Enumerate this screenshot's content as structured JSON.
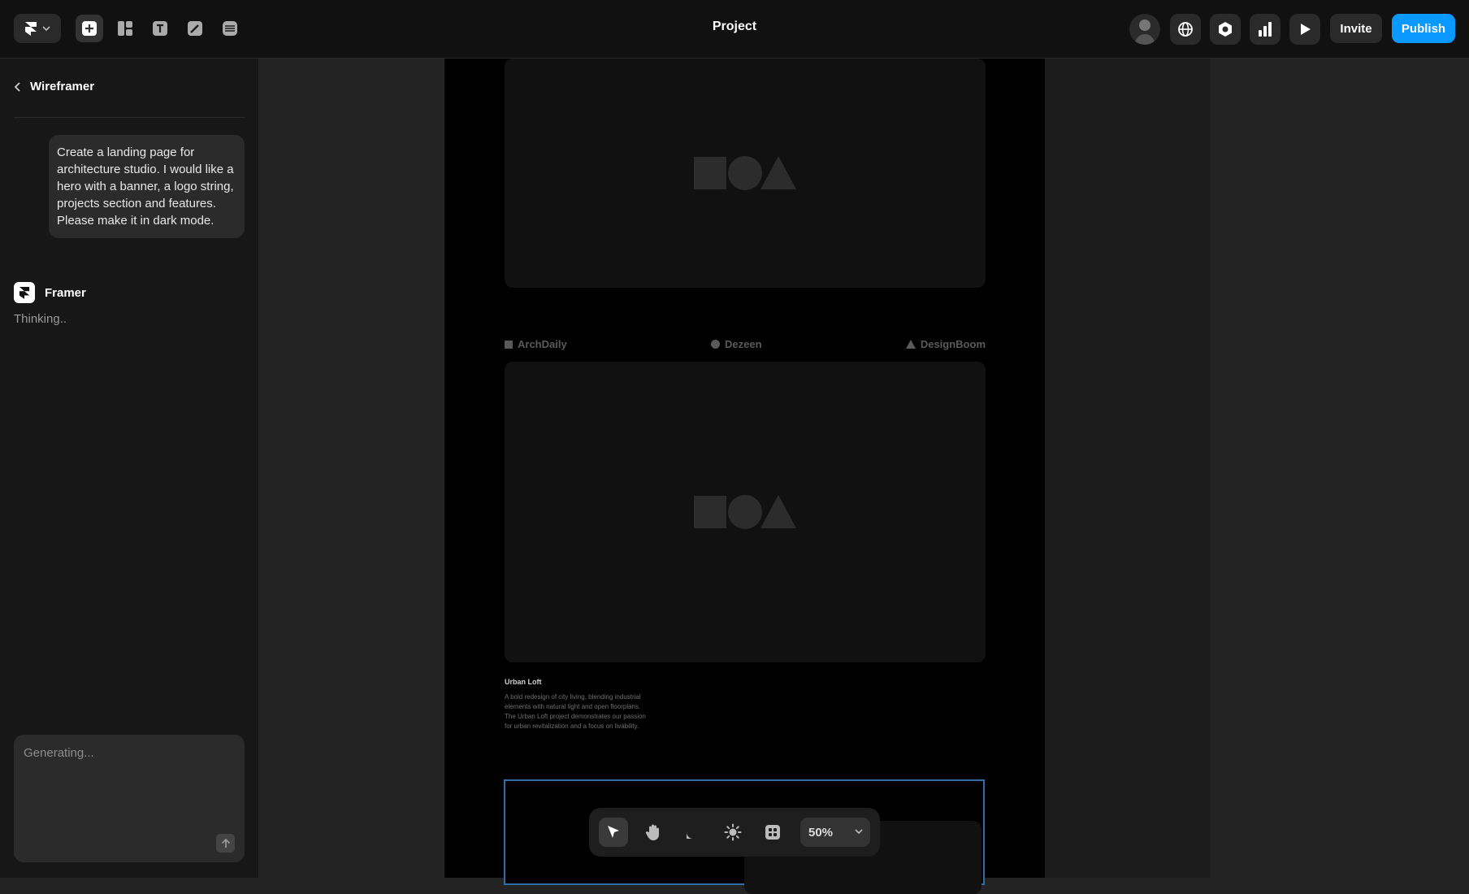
{
  "header": {
    "project_title": "Project",
    "tools": [
      {
        "name": "insert",
        "icon": "plus-square-icon"
      },
      {
        "name": "layout",
        "icon": "layout-icon"
      },
      {
        "name": "text",
        "icon": "text-icon"
      },
      {
        "name": "vector",
        "icon": "pen-icon"
      },
      {
        "name": "cms",
        "icon": "database-icon"
      }
    ],
    "invite_label": "Invite",
    "publish_label": "Publish",
    "accent_color": "#0a99ff"
  },
  "sidebar": {
    "back_label": "Wireframer",
    "user_message": "Create a landing page for architecture studio. I would like a hero with a banner, a logo string, projects section and features. Please make it in dark mode.",
    "assistant_name": "Framer",
    "assistant_status": "Thinking..",
    "prompt_placeholder": "Generating..."
  },
  "canvas": {
    "logo_string": [
      {
        "label": "ArchDaily",
        "shape": "square"
      },
      {
        "label": "Dezeen",
        "shape": "circle"
      },
      {
        "label": "DesignBoom",
        "shape": "triangle"
      }
    ],
    "project": {
      "title": "Urban Loft",
      "description": "A bold redesign of city living, blending industrial elements with natural light and open floorplans. The Urban Loft project demonstrates our passion for urban revitalization and a focus on livability."
    }
  },
  "bottom_toolbar": {
    "tools": [
      "select",
      "hand",
      "comment",
      "theme",
      "components"
    ],
    "zoom": "50%"
  }
}
